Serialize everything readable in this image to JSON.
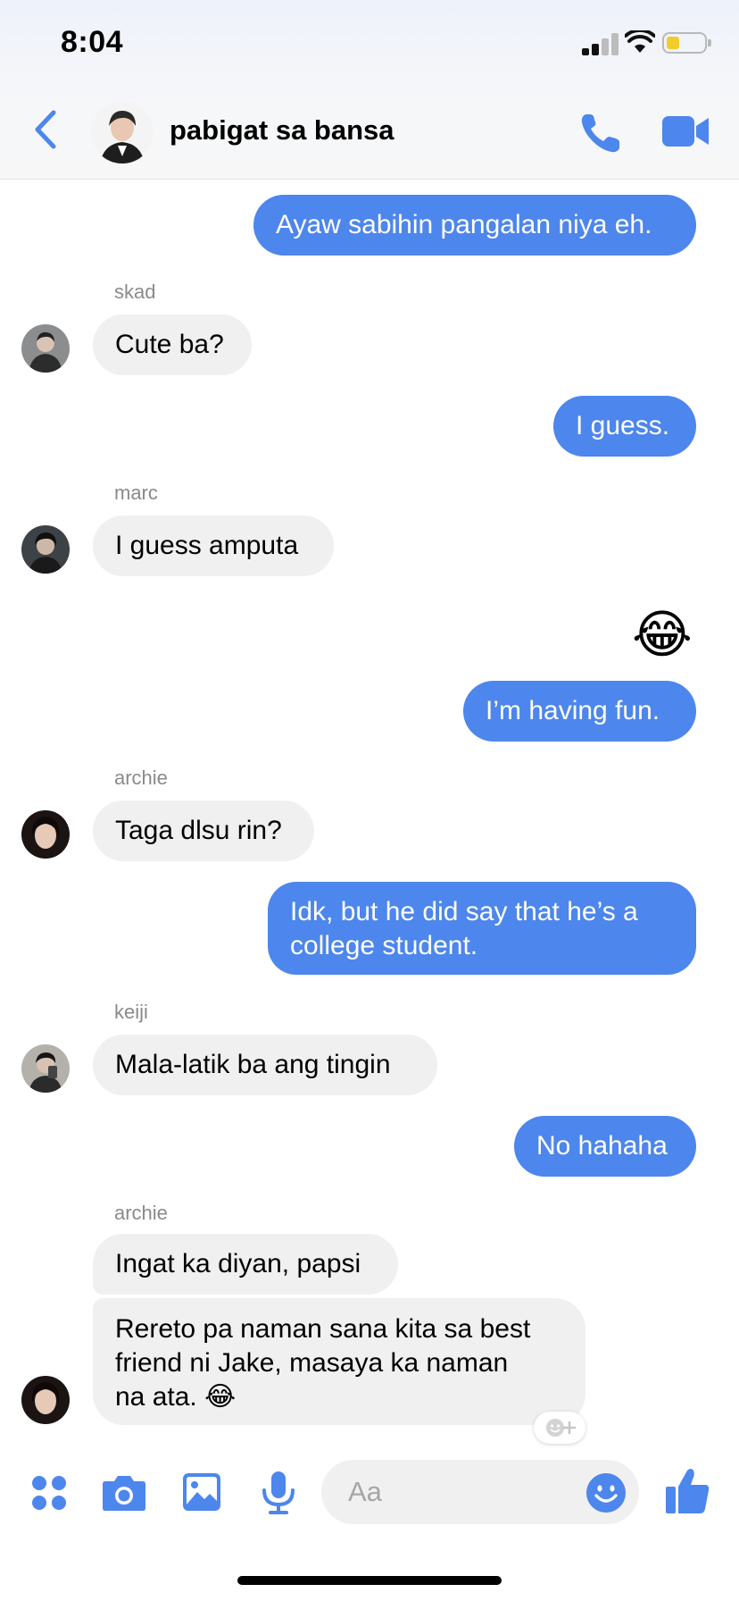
{
  "status": {
    "time": "8:04"
  },
  "header": {
    "title": "pabigat sa bansa"
  },
  "colors": {
    "accent": "#4d86ec",
    "incoming": "#f0f0f0"
  },
  "messages": [
    {
      "dir": "out",
      "text": "Ayaw sabihin pangalan niya eh."
    },
    {
      "dir": "in",
      "sender": "skad",
      "text": "Cute ba?"
    },
    {
      "dir": "out",
      "text": "I guess."
    },
    {
      "dir": "in",
      "sender": "marc",
      "text": "I guess amputa"
    },
    {
      "dir": "out",
      "emoji": "😂"
    },
    {
      "dir": "out",
      "text": "I’m having fun."
    },
    {
      "dir": "in",
      "sender": "archie",
      "text": "Taga dlsu rin?"
    },
    {
      "dir": "out",
      "lines": [
        "Idk, but he did say that he’s a",
        "college student."
      ]
    },
    {
      "dir": "in",
      "sender": "keiji",
      "text": "Mala-latik ba ang tingin"
    },
    {
      "dir": "out",
      "text": "No hahaha"
    },
    {
      "dir": "in",
      "sender": "archie",
      "text": "Ingat ka diyan, papsi"
    },
    {
      "dir": "in",
      "lines": [
        "Rereto pa naman sana kita sa best",
        "friend ni Jake, masaya ka naman",
        "na ata."
      ],
      "emoji": "😂"
    }
  ],
  "composer": {
    "placeholder": "Aa"
  },
  "icons": [
    "chevron-left",
    "phone",
    "video-camera",
    "apps-grid",
    "camera",
    "gallery",
    "microphone",
    "smiley",
    "thumbs-up",
    "add-reaction"
  ]
}
